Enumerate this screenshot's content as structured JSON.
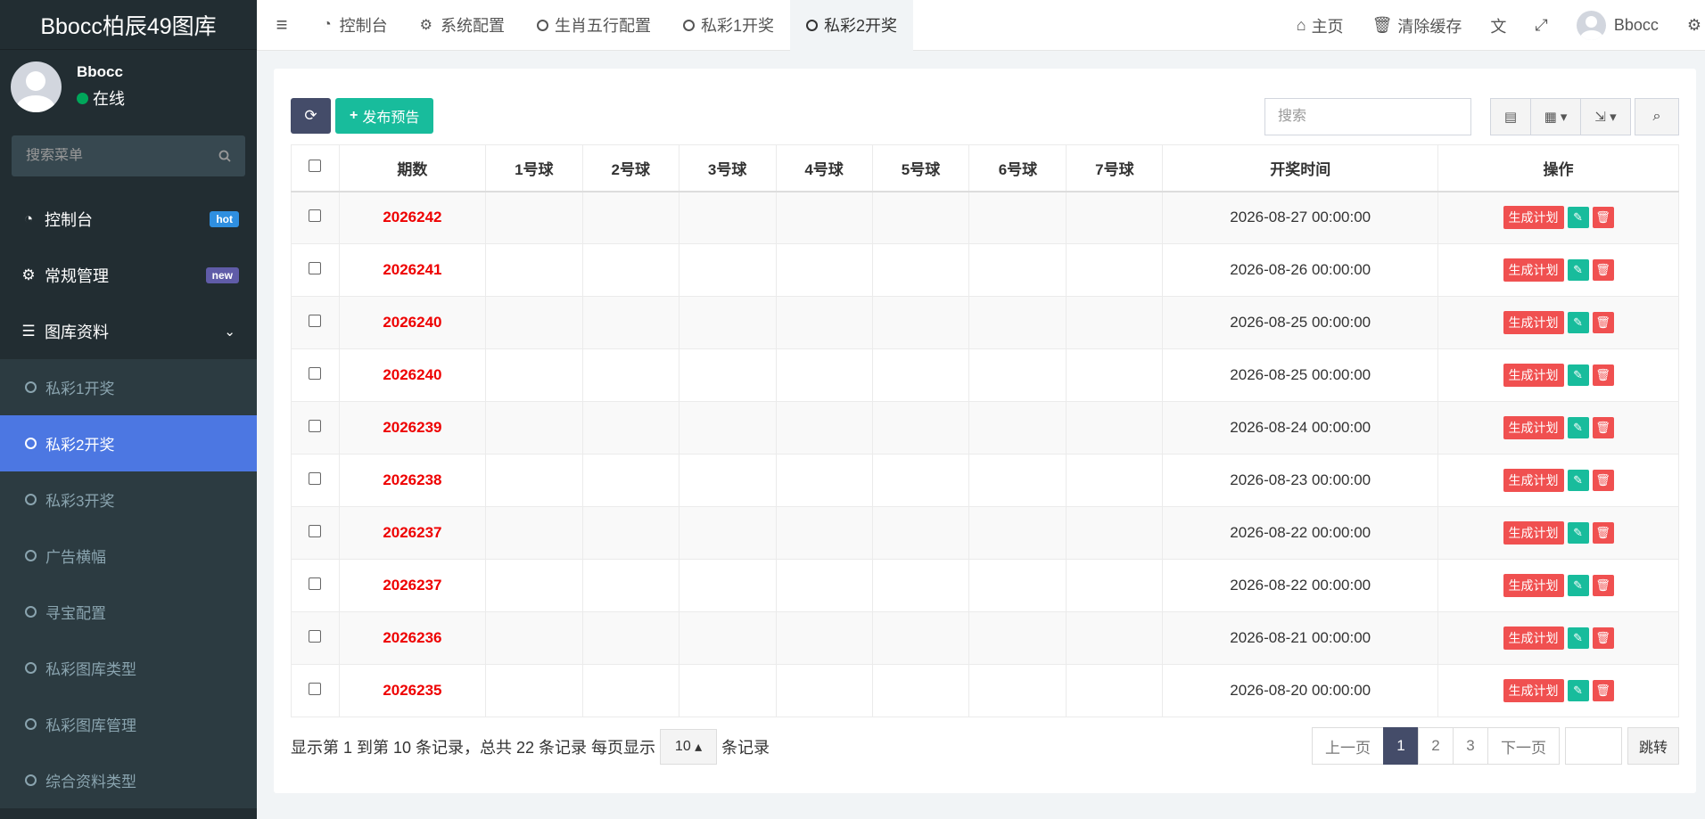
{
  "brand": "Bbocc柏辰49图库",
  "user": {
    "name": "Bbocc",
    "status": "在线"
  },
  "sidebar": {
    "search_placeholder": "搜索菜单",
    "items": [
      {
        "label": "控制台",
        "icon": "dashboard-icon",
        "badge": "hot"
      },
      {
        "label": "常规管理",
        "icon": "cogs-icon",
        "badge": "new"
      },
      {
        "label": "图库资料",
        "icon": "list-icon"
      }
    ],
    "subitems": [
      {
        "label": "私彩1开奖",
        "active": false
      },
      {
        "label": "私彩2开奖",
        "active": true
      },
      {
        "label": "私彩3开奖",
        "active": false
      },
      {
        "label": "广告横幅",
        "active": false
      },
      {
        "label": "寻宝配置",
        "active": false
      },
      {
        "label": "私彩图库类型",
        "active": false
      },
      {
        "label": "私彩图库管理",
        "active": false
      },
      {
        "label": "综合资料类型",
        "active": false
      }
    ]
  },
  "topbar": {
    "tabs": [
      {
        "label": "控制台",
        "icon": "dashboard-icon"
      },
      {
        "label": "系统配置",
        "icon": "gear-icon"
      },
      {
        "label": "生肖五行配置",
        "icon": "circle-icon"
      },
      {
        "label": "私彩1开奖",
        "icon": "circle-icon"
      },
      {
        "label": "私彩2开奖",
        "icon": "circle-icon",
        "active": true
      }
    ],
    "home": "主页",
    "clear_cache": "清除缓存",
    "username": "Bbocc"
  },
  "toolbar": {
    "add_label": "发布预告",
    "search_placeholder": "搜索"
  },
  "table": {
    "headers": [
      "期数",
      "1号球",
      "2号球",
      "3号球",
      "4号球",
      "5号球",
      "6号球",
      "7号球",
      "开奖时间",
      "操作"
    ],
    "plan_label": "生成计划",
    "rows": [
      {
        "period": "2026242",
        "time": "2026-08-27 00:00:00"
      },
      {
        "period": "2026241",
        "time": "2026-08-26 00:00:00"
      },
      {
        "period": "2026240",
        "time": "2026-08-25 00:00:00"
      },
      {
        "period": "2026240",
        "time": "2026-08-25 00:00:00"
      },
      {
        "period": "2026239",
        "time": "2026-08-24 00:00:00"
      },
      {
        "period": "2026238",
        "time": "2026-08-23 00:00:00"
      },
      {
        "period": "2026237",
        "time": "2026-08-22 00:00:00"
      },
      {
        "period": "2026237",
        "time": "2026-08-22 00:00:00"
      },
      {
        "period": "2026236",
        "time": "2026-08-21 00:00:00"
      },
      {
        "period": "2026235",
        "time": "2026-08-20 00:00:00"
      }
    ]
  },
  "footer": {
    "info_prefix": "显示第 1 到第 10 条记录，总共 22 条记录 每页显示",
    "page_size": "10",
    "info_suffix": "条记录",
    "prev": "上一页",
    "pages": [
      "1",
      "2",
      "3"
    ],
    "current_page": "1",
    "next": "下一页",
    "go": "跳转"
  }
}
